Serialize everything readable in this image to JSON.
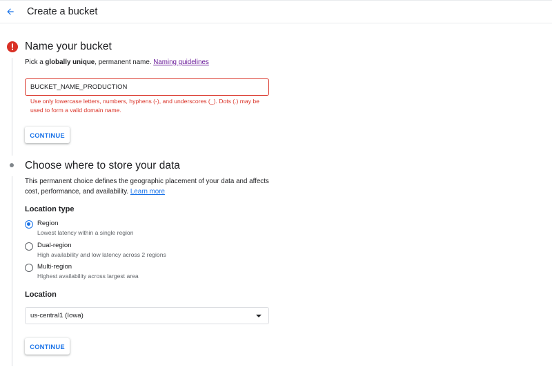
{
  "header": {
    "title": "Create a bucket"
  },
  "step_name": {
    "heading": "Name your bucket",
    "desc_prefix": "Pick a ",
    "desc_bold": "globally unique",
    "desc_suffix": ", permanent name.",
    "naming_link": "Naming guidelines",
    "input_value": "BUCKET_NAME_PRODUCTION",
    "error_line1": "Use only lowercase letters, numbers, hyphens (-), and underscores (_). Dots (.) may be",
    "error_line2": "used to form a valid domain name.",
    "continue_label": "CONTINUE"
  },
  "step_location": {
    "heading": "Choose where to store your data",
    "desc_line1": "This permanent choice defines the geographic placement of your data and affects",
    "desc_line2_prefix": "cost, performance, and availability.",
    "learn_more": "Learn more",
    "location_type_heading": "Location type",
    "options": [
      {
        "label": "Region",
        "sub": "Lowest latency within a single region",
        "checked": true
      },
      {
        "label": "Dual-region",
        "sub": "High availability and low latency across 2 regions",
        "checked": false
      },
      {
        "label": "Multi-region",
        "sub": "Highest availability across largest area",
        "checked": false
      }
    ],
    "location_heading": "Location",
    "location_value": "us-central1 (Iowa)",
    "continue_label": "CONTINUE"
  },
  "colors": {
    "accent": "#1a73e8",
    "error": "#d93025",
    "visited_link": "#6a1b9a",
    "text": "#202124",
    "secondary_text": "#5f6368"
  },
  "icons": {
    "back": "arrow-back-icon",
    "error": "error-icon",
    "dropdown": "caret-down-icon"
  }
}
